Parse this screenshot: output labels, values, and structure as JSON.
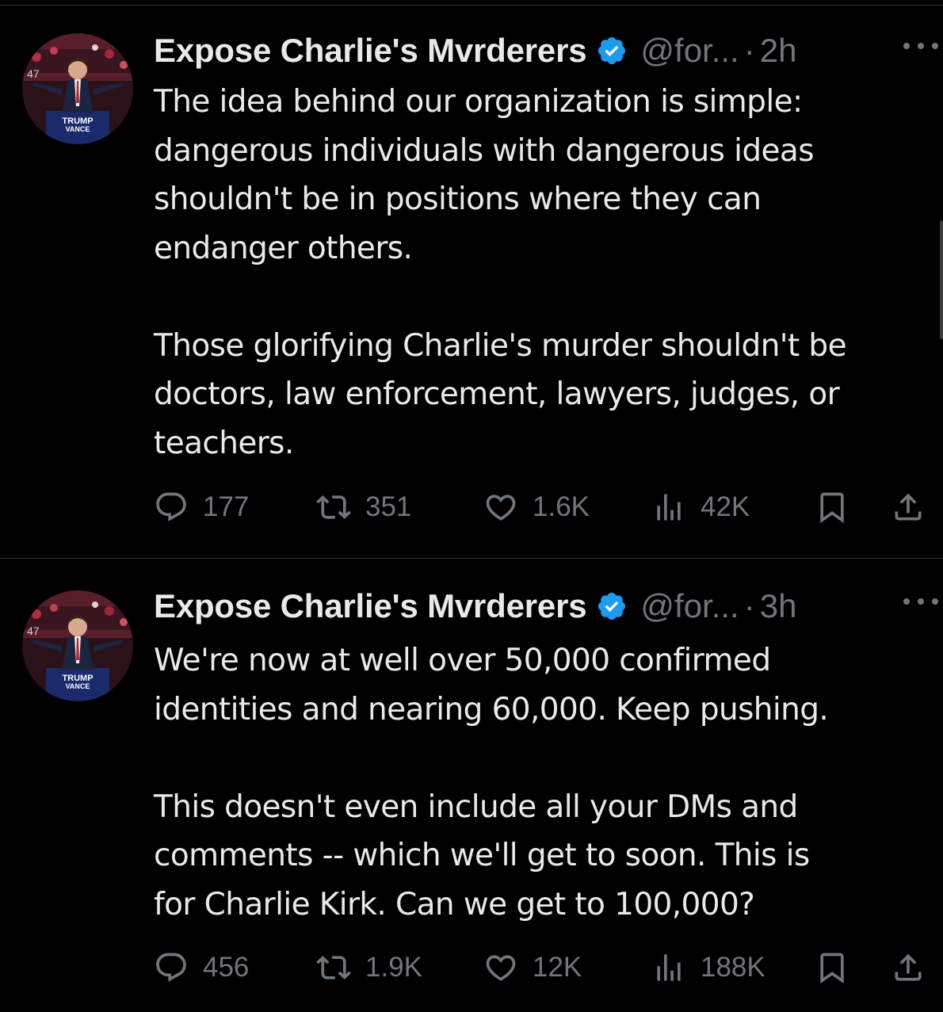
{
  "tweets": [
    {
      "author_name": "Expose Charlie's Mvrderers",
      "handle": "@for...",
      "separator": "·",
      "time": "2h",
      "avatar_sign_line1": "TRUMP",
      "avatar_sign_line2": "VANCE",
      "avatar_number": "47",
      "paragraphs": [
        [
          "The idea behind our organization is simple:",
          "dangerous individuals with dangerous ideas",
          "shouldn't be in positions where they can",
          "endanger others."
        ],
        [
          "Those glorifying Charlie's murder shouldn't be",
          "doctors, law enforcement, lawyers, judges, or",
          "teachers."
        ]
      ],
      "replies": "177",
      "retweets": "351",
      "likes": "1.6K",
      "views": "42K"
    },
    {
      "author_name": "Expose Charlie's Mvrderers",
      "handle": "@for...",
      "separator": "·",
      "time": "3h",
      "avatar_sign_line1": "TRUMP",
      "avatar_sign_line2": "VANCE",
      "avatar_number": "47",
      "paragraphs": [
        [
          "We're now at well over 50,000 confirmed",
          "identities and nearing 60,000. Keep pushing."
        ],
        [
          "This doesn't even include all your DMs and",
          "comments -- which we'll get to soon. This is",
          "for Charlie Kirk. Can we get to 100,000?"
        ]
      ],
      "replies": "456",
      "retweets": "1.9K",
      "likes": "12K",
      "views": "188K"
    }
  ],
  "colors": {
    "background": "#000000",
    "text": "#e7e9ea",
    "muted": "#71767b",
    "verified": "#1d9bf0",
    "divider": "#2f3336"
  },
  "icons": [
    "reply-icon",
    "retweet-icon",
    "like-icon",
    "views-icon",
    "bookmark-icon",
    "share-icon",
    "verified-badge-icon",
    "more-icon"
  ]
}
